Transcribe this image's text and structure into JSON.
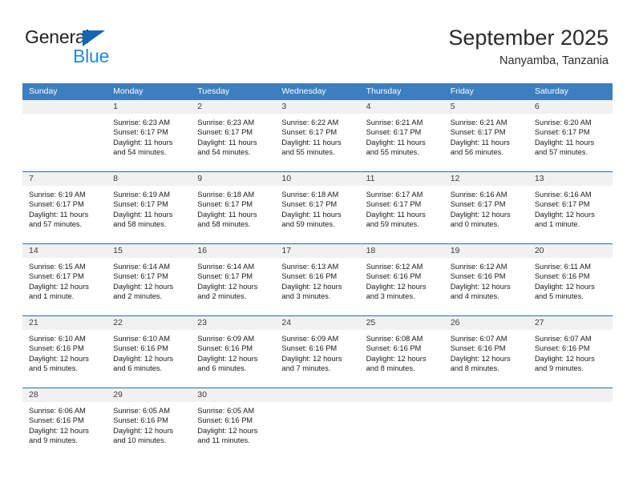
{
  "brand": {
    "name_part1": "General",
    "name_part2": "Blue",
    "color_dark": "#231f20",
    "color_blue": "#2688d4",
    "triangle_color": "#1268b3"
  },
  "header": {
    "title": "September 2025",
    "subtitle": "Nanyamba, Tanzania"
  },
  "theme": {
    "header_bg": "#3c7ebf",
    "row_separator": "#2e6ca4",
    "daynum_bg": "#f1f1f1"
  },
  "calendar": {
    "weekdays": [
      "Sunday",
      "Monday",
      "Tuesday",
      "Wednesday",
      "Thursday",
      "Friday",
      "Saturday"
    ],
    "weeks": [
      [
        {
          "day": "",
          "lines": []
        },
        {
          "day": "1",
          "lines": [
            "Sunrise: 6:23 AM",
            "Sunset: 6:17 PM",
            "Daylight: 11 hours",
            "and 54 minutes."
          ]
        },
        {
          "day": "2",
          "lines": [
            "Sunrise: 6:23 AM",
            "Sunset: 6:17 PM",
            "Daylight: 11 hours",
            "and 54 minutes."
          ]
        },
        {
          "day": "3",
          "lines": [
            "Sunrise: 6:22 AM",
            "Sunset: 6:17 PM",
            "Daylight: 11 hours",
            "and 55 minutes."
          ]
        },
        {
          "day": "4",
          "lines": [
            "Sunrise: 6:21 AM",
            "Sunset: 6:17 PM",
            "Daylight: 11 hours",
            "and 55 minutes."
          ]
        },
        {
          "day": "5",
          "lines": [
            "Sunrise: 6:21 AM",
            "Sunset: 6:17 PM",
            "Daylight: 11 hours",
            "and 56 minutes."
          ]
        },
        {
          "day": "6",
          "lines": [
            "Sunrise: 6:20 AM",
            "Sunset: 6:17 PM",
            "Daylight: 11 hours",
            "and 57 minutes."
          ]
        }
      ],
      [
        {
          "day": "7",
          "lines": [
            "Sunrise: 6:19 AM",
            "Sunset: 6:17 PM",
            "Daylight: 11 hours",
            "and 57 minutes."
          ]
        },
        {
          "day": "8",
          "lines": [
            "Sunrise: 6:19 AM",
            "Sunset: 6:17 PM",
            "Daylight: 11 hours",
            "and 58 minutes."
          ]
        },
        {
          "day": "9",
          "lines": [
            "Sunrise: 6:18 AM",
            "Sunset: 6:17 PM",
            "Daylight: 11 hours",
            "and 58 minutes."
          ]
        },
        {
          "day": "10",
          "lines": [
            "Sunrise: 6:18 AM",
            "Sunset: 6:17 PM",
            "Daylight: 11 hours",
            "and 59 minutes."
          ]
        },
        {
          "day": "11",
          "lines": [
            "Sunrise: 6:17 AM",
            "Sunset: 6:17 PM",
            "Daylight: 11 hours",
            "and 59 minutes."
          ]
        },
        {
          "day": "12",
          "lines": [
            "Sunrise: 6:16 AM",
            "Sunset: 6:17 PM",
            "Daylight: 12 hours",
            "and 0 minutes."
          ]
        },
        {
          "day": "13",
          "lines": [
            "Sunrise: 6:16 AM",
            "Sunset: 6:17 PM",
            "Daylight: 12 hours",
            "and 1 minute."
          ]
        }
      ],
      [
        {
          "day": "14",
          "lines": [
            "Sunrise: 6:15 AM",
            "Sunset: 6:17 PM",
            "Daylight: 12 hours",
            "and 1 minute."
          ]
        },
        {
          "day": "15",
          "lines": [
            "Sunrise: 6:14 AM",
            "Sunset: 6:17 PM",
            "Daylight: 12 hours",
            "and 2 minutes."
          ]
        },
        {
          "day": "16",
          "lines": [
            "Sunrise: 6:14 AM",
            "Sunset: 6:17 PM",
            "Daylight: 12 hours",
            "and 2 minutes."
          ]
        },
        {
          "day": "17",
          "lines": [
            "Sunrise: 6:13 AM",
            "Sunset: 6:16 PM",
            "Daylight: 12 hours",
            "and 3 minutes."
          ]
        },
        {
          "day": "18",
          "lines": [
            "Sunrise: 6:12 AM",
            "Sunset: 6:16 PM",
            "Daylight: 12 hours",
            "and 3 minutes."
          ]
        },
        {
          "day": "19",
          "lines": [
            "Sunrise: 6:12 AM",
            "Sunset: 6:16 PM",
            "Daylight: 12 hours",
            "and 4 minutes."
          ]
        },
        {
          "day": "20",
          "lines": [
            "Sunrise: 6:11 AM",
            "Sunset: 6:16 PM",
            "Daylight: 12 hours",
            "and 5 minutes."
          ]
        }
      ],
      [
        {
          "day": "21",
          "lines": [
            "Sunrise: 6:10 AM",
            "Sunset: 6:16 PM",
            "Daylight: 12 hours",
            "and 5 minutes."
          ]
        },
        {
          "day": "22",
          "lines": [
            "Sunrise: 6:10 AM",
            "Sunset: 6:16 PM",
            "Daylight: 12 hours",
            "and 6 minutes."
          ]
        },
        {
          "day": "23",
          "lines": [
            "Sunrise: 6:09 AM",
            "Sunset: 6:16 PM",
            "Daylight: 12 hours",
            "and 6 minutes."
          ]
        },
        {
          "day": "24",
          "lines": [
            "Sunrise: 6:09 AM",
            "Sunset: 6:16 PM",
            "Daylight: 12 hours",
            "and 7 minutes."
          ]
        },
        {
          "day": "25",
          "lines": [
            "Sunrise: 6:08 AM",
            "Sunset: 6:16 PM",
            "Daylight: 12 hours",
            "and 8 minutes."
          ]
        },
        {
          "day": "26",
          "lines": [
            "Sunrise: 6:07 AM",
            "Sunset: 6:16 PM",
            "Daylight: 12 hours",
            "and 8 minutes."
          ]
        },
        {
          "day": "27",
          "lines": [
            "Sunrise: 6:07 AM",
            "Sunset: 6:16 PM",
            "Daylight: 12 hours",
            "and 9 minutes."
          ]
        }
      ],
      [
        {
          "day": "28",
          "lines": [
            "Sunrise: 6:06 AM",
            "Sunset: 6:16 PM",
            "Daylight: 12 hours",
            "and 9 minutes."
          ]
        },
        {
          "day": "29",
          "lines": [
            "Sunrise: 6:05 AM",
            "Sunset: 6:16 PM",
            "Daylight: 12 hours",
            "and 10 minutes."
          ]
        },
        {
          "day": "30",
          "lines": [
            "Sunrise: 6:05 AM",
            "Sunset: 6:16 PM",
            "Daylight: 12 hours",
            "and 11 minutes."
          ]
        },
        {
          "day": "",
          "lines": []
        },
        {
          "day": "",
          "lines": []
        },
        {
          "day": "",
          "lines": []
        },
        {
          "day": "",
          "lines": []
        }
      ]
    ]
  }
}
